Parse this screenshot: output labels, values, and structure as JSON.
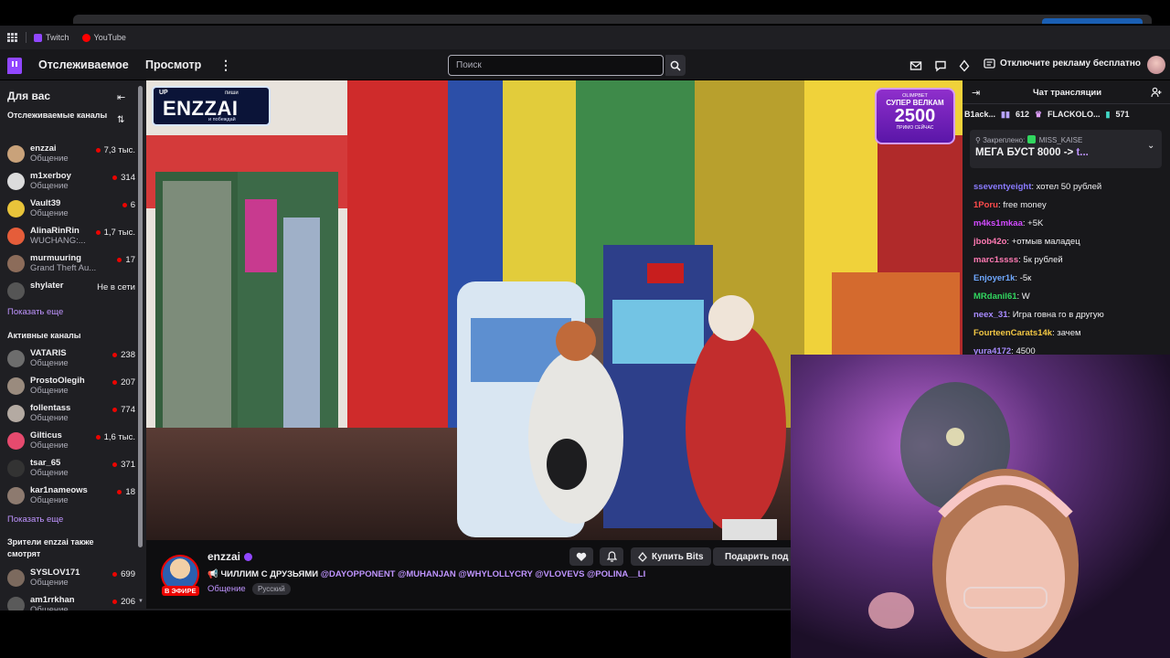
{
  "browser": {
    "bookmarks": [
      {
        "label": "Twitch",
        "color": "#9147ff"
      },
      {
        "label": "YouTube",
        "color": "#ff0000"
      }
    ]
  },
  "nav": {
    "following": "Отслеживаемое",
    "browse": "Просмотр",
    "search_placeholder": "Поиск",
    "adfree": "Отключите рекламу бесплатно"
  },
  "sidebar": {
    "header": "Для вас",
    "followed_title": "Отслеживаемые каналы",
    "followed": [
      {
        "name": "enzzai",
        "game": "Общение",
        "viewers": "7,3 тыс.",
        "live": true,
        "color": "#c9a27a"
      },
      {
        "name": "m1xerboy",
        "game": "Общение",
        "viewers": "314",
        "live": true,
        "color": "#dcdcdc"
      },
      {
        "name": "Vault39",
        "game": "Общение",
        "viewers": "6",
        "live": true,
        "color": "#e8c43a"
      },
      {
        "name": "AlinaRinRin",
        "game": "WUCHANG:...",
        "viewers": "1,7 тыс.",
        "live": true,
        "color": "#e55d3a"
      },
      {
        "name": "murmuuring",
        "game": "Grand Theft Au...",
        "viewers": "17",
        "live": true,
        "color": "#8c6c5a"
      },
      {
        "name": "shylater",
        "game": "",
        "viewers": "Не в сети",
        "live": false,
        "color": "#555"
      }
    ],
    "show_more": "Показать еще",
    "active_title": "Активные каналы",
    "active": [
      {
        "name": "VATARIS",
        "game": "Общение",
        "viewers": "238",
        "color": "#6d6d6d"
      },
      {
        "name": "ProstoOlegih",
        "game": "Общение",
        "viewers": "207",
        "color": "#9a8b7e"
      },
      {
        "name": "follentass",
        "game": "Общение",
        "viewers": "774",
        "color": "#b4aaa2"
      },
      {
        "name": "Gilticus",
        "game": "Общение",
        "viewers": "1,6 тыс.",
        "color": "#e64a6e"
      },
      {
        "name": "tsar_65",
        "game": "Общение",
        "viewers": "371",
        "color": "#333"
      },
      {
        "name": "kar1nameows",
        "game": "Общение",
        "viewers": "18",
        "color": "#8d7a6f"
      }
    ],
    "show_more2": "Показать еще",
    "viewers_also_title": "Зрители enzzai также смотрят",
    "also": [
      {
        "name": "SYSLOV171",
        "game": "Общение",
        "viewers": "699",
        "color": "#7c6a5e"
      },
      {
        "name": "am1rrkhan",
        "game": "Общение",
        "viewers": "206",
        "color": "#5a5a5a"
      }
    ]
  },
  "video": {
    "badge_up": "UP",
    "badge_word": "ENZZAI",
    "badge_top": "пиши",
    "badge_bottom": "и побеждай",
    "promo_top": "OLIMPBET",
    "promo_mid": "СУПЕР ВЕЛКАМ",
    "promo_num": "2500",
    "promo_bot": "ПРИМО СЕЙЧАС"
  },
  "stream": {
    "live_label": "В ЭФИРЕ",
    "name": "enzzai",
    "title": "ЧИЛЛИМ С ДРУЗЬЯМИ",
    "mentions": [
      "@DAYOPPONENT",
      "@MUHANJAN",
      "@WHYLOLLYCRY",
      "@VLOVEVS",
      "@POLINA__LI"
    ],
    "category": "Общение",
    "tag": "Русский",
    "buy_bits": "Купить Bits",
    "gift": "Подарить под"
  },
  "chat": {
    "title": "Чат трансляции",
    "leaders": [
      {
        "name": "B1ack...",
        "value": "612"
      },
      {
        "name": "FLACKOLO...",
        "value": "571"
      }
    ],
    "pinned_label": "Закреплено:",
    "pinned_by": "MISS_KAISE",
    "pinned_text": "МЕГА БУСТ 8000 -> ",
    "pinned_link": "t...",
    "messages": [
      {
        "user": "sseventyeight",
        "color": "#8a7bff",
        "text": "хотел 50 рублей"
      },
      {
        "user": "1Poru",
        "color": "#ff4b4b",
        "text": "free money"
      },
      {
        "user": "m4ks1mkaa",
        "color": "#d24bff",
        "text": "+5K"
      },
      {
        "user": "jbob42o",
        "color": "#ff7ab3",
        "text": "+отмыв маладец"
      },
      {
        "user": "marc1ssss",
        "color": "#ff7ab3",
        "text": "5к рублей"
      },
      {
        "user": "Enjoyer1k",
        "color": "#6fa8ff",
        "text": "-5к"
      },
      {
        "user": "MRdanil61",
        "color": "#31d65f",
        "text": "W"
      },
      {
        "user": "neex_31",
        "color": "#a88bff",
        "text": "Игра говна го в другую"
      },
      {
        "user": "FourteenCarats14k",
        "color": "#f2c744",
        "text": "зачем"
      },
      {
        "user": "yura4172",
        "color": "#a88bff",
        "text": "4500"
      }
    ]
  }
}
